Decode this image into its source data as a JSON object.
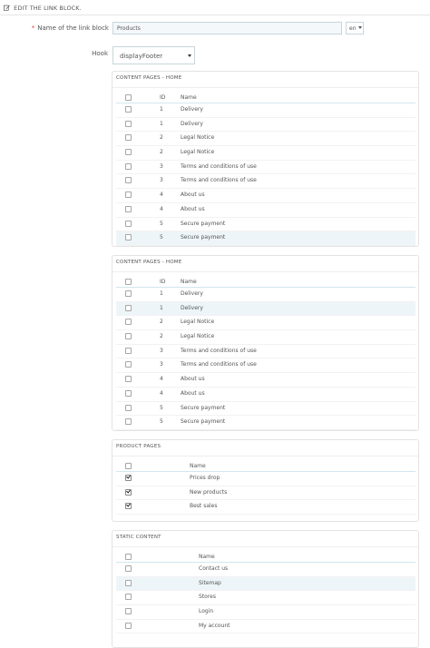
{
  "panel": {
    "title": "EDIT THE LINK BLOCK."
  },
  "form": {
    "name_label": "Name of the link block",
    "name_required_marker": "*",
    "name_value": "Products",
    "language": "en",
    "hook_label": "Hook",
    "hook_value": "displayFooter"
  },
  "cms_home_1": {
    "title": "CONTENT PAGES - HOME",
    "columns": {
      "id": "ID",
      "name": "Name"
    },
    "rows": [
      {
        "id": "1",
        "name": "Delivery",
        "checked": false,
        "highlight": false
      },
      {
        "id": "1",
        "name": "Delivery",
        "checked": false,
        "highlight": false
      },
      {
        "id": "2",
        "name": "Legal Notice",
        "checked": false,
        "highlight": false
      },
      {
        "id": "2",
        "name": "Legal Notice",
        "checked": false,
        "highlight": false
      },
      {
        "id": "3",
        "name": "Terms and conditions of use",
        "checked": false,
        "highlight": false
      },
      {
        "id": "3",
        "name": "Terms and conditions of use",
        "checked": false,
        "highlight": false
      },
      {
        "id": "4",
        "name": "About us",
        "checked": false,
        "highlight": false
      },
      {
        "id": "4",
        "name": "About us",
        "checked": false,
        "highlight": false
      },
      {
        "id": "5",
        "name": "Secure payment",
        "checked": false,
        "highlight": false
      },
      {
        "id": "5",
        "name": "Secure payment",
        "checked": false,
        "highlight": true
      }
    ]
  },
  "cms_home_2": {
    "title": "CONTENT PAGES - HOME",
    "columns": {
      "id": "ID",
      "name": "Name"
    },
    "rows": [
      {
        "id": "1",
        "name": "Delivery",
        "checked": false,
        "highlight": false
      },
      {
        "id": "1",
        "name": "Delivery",
        "checked": false,
        "highlight": true
      },
      {
        "id": "2",
        "name": "Legal Notice",
        "checked": false,
        "highlight": false
      },
      {
        "id": "2",
        "name": "Legal Notice",
        "checked": false,
        "highlight": false
      },
      {
        "id": "3",
        "name": "Terms and conditions of use",
        "checked": false,
        "highlight": false
      },
      {
        "id": "3",
        "name": "Terms and conditions of use",
        "checked": false,
        "highlight": false
      },
      {
        "id": "4",
        "name": "About us",
        "checked": false,
        "highlight": false
      },
      {
        "id": "4",
        "name": "About us",
        "checked": false,
        "highlight": false
      },
      {
        "id": "5",
        "name": "Secure payment",
        "checked": false,
        "highlight": false
      },
      {
        "id": "5",
        "name": "Secure payment",
        "checked": false,
        "highlight": false
      }
    ]
  },
  "product_pages": {
    "title": "PRODUCT PAGES",
    "columns": {
      "name": "Name"
    },
    "rows": [
      {
        "name": "Prices drop",
        "checked": true,
        "highlight": false
      },
      {
        "name": "New products",
        "checked": true,
        "highlight": false
      },
      {
        "name": "Best sales",
        "checked": true,
        "highlight": false
      }
    ]
  },
  "static_content": {
    "title": "STATIC CONTENT",
    "columns": {
      "name": "Name"
    },
    "rows": [
      {
        "name": "Contact us",
        "checked": false,
        "highlight": false
      },
      {
        "name": "Sitemap",
        "checked": false,
        "highlight": true
      },
      {
        "name": "Stores",
        "checked": false,
        "highlight": false
      },
      {
        "name": "Login",
        "checked": false,
        "highlight": false
      },
      {
        "name": "My account",
        "checked": false,
        "highlight": false
      }
    ]
  }
}
